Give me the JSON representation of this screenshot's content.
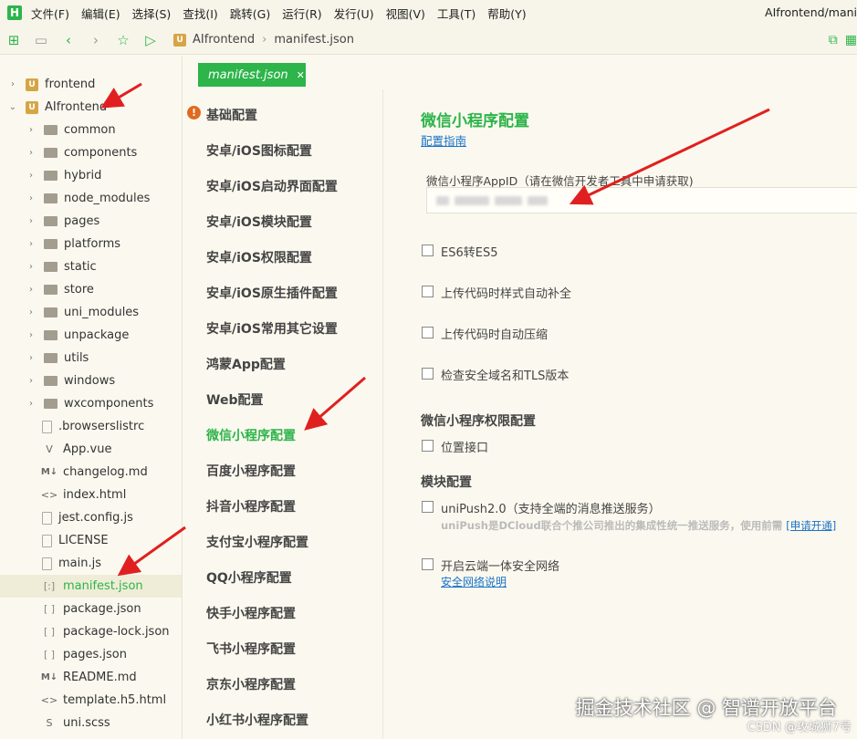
{
  "app_logo": "H",
  "menus": [
    "文件(F)",
    "编辑(E)",
    "选择(S)",
    "查找(I)",
    "跳转(G)",
    "运行(R)",
    "发行(U)",
    "视图(V)",
    "工具(T)",
    "帮助(Y)"
  ],
  "window_title": "AIfrontend/mani",
  "breadcrumb": {
    "project": "AIfrontend",
    "file": "manifest.json"
  },
  "tree": {
    "root1": "frontend",
    "root2": "AIfrontend",
    "folders": [
      "common",
      "components",
      "hybrid",
      "node_modules",
      "pages",
      "platforms",
      "static",
      "store",
      "uni_modules",
      "unpackage",
      "utils",
      "windows",
      "wxcomponents"
    ],
    "files": [
      ".browserslistrc",
      "App.vue",
      "changelog.md",
      "index.html",
      "jest.config.js",
      "LICENSE",
      "main.js",
      "manifest.json",
      "package.json",
      "package-lock.json",
      "pages.json",
      "README.md",
      "template.h5.html",
      "uni.scss"
    ],
    "file_icons": [
      "file",
      "V",
      "M↓",
      "<>",
      "file",
      "file",
      "file",
      "[:]",
      "[ ]",
      "[ ]",
      "[ ]",
      "M↓",
      "<>",
      "S"
    ]
  },
  "tab": {
    "label": "manifest.json",
    "close": "✕"
  },
  "config_nav": [
    "基础配置",
    "安卓/iOS图标配置",
    "安卓/iOS启动界面配置",
    "安卓/iOS模块配置",
    "安卓/iOS权限配置",
    "安卓/iOS原生插件配置",
    "安卓/iOS常用其它设置",
    "鸿蒙App配置",
    "Web配置",
    "微信小程序配置",
    "百度小程序配置",
    "抖音小程序配置",
    "支付宝小程序配置",
    "QQ小程序配置",
    "快手小程序配置",
    "飞书小程序配置",
    "京东小程序配置",
    "小红书小程序配置"
  ],
  "main": {
    "title": "微信小程序配置",
    "guide_link": "配置指南",
    "appid_label": "微信小程序AppID（请在微信开发者工具中申请获取)",
    "checkboxes": [
      "ES6转ES5",
      "上传代码时样式自动补全",
      "上传代码时自动压缩",
      "检查安全域名和TLS版本"
    ],
    "perm_section": "微信小程序权限配置",
    "perm_checkbox": "位置接口",
    "module_section": "模块配置",
    "unipush_label": "uniPush2.0（支持全端的消息推送服务）",
    "unipush_note": "uniPush是DCloud联合个推公司推出的集成性统一推送服务，使用前需",
    "unipush_link": "[申请开通]",
    "secure_label": "开启云端一体安全网络",
    "secure_link": "安全网络说明"
  },
  "watermark": "掘金技术社区 @ 智谱开放平台",
  "watermark2": "CSDN @攻城狮7号",
  "colors": {
    "accent": "#2db44a",
    "background": "#fbf9ef",
    "warning": "#e06a1f",
    "link": "#1a73c8",
    "arrow": "#e02020"
  }
}
